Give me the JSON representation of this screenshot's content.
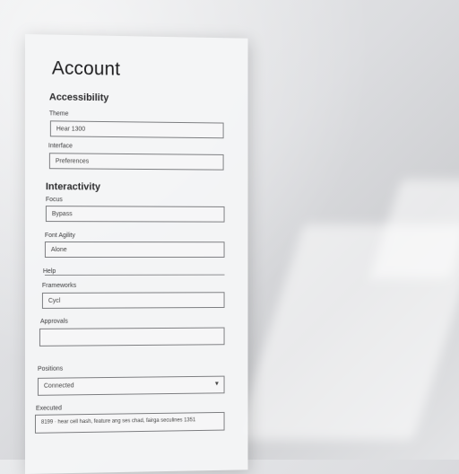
{
  "form": {
    "title": "Account",
    "section_account": "Accessibility",
    "label_1": "Theme",
    "value_1": "Hear 1300",
    "label_2": "Interface",
    "value_2": "Preferences",
    "section_interactivity": "Interactivity",
    "label_3": "Focus",
    "value_3": "Bypass",
    "label_4": "Font Agility",
    "value_4": "Alone",
    "label_5": "Help",
    "label_6": "Frameworks",
    "value_6": "Cycl",
    "label_7": "Approvals",
    "value_7": "",
    "label_8": "Positions",
    "select_value": "Connected",
    "label_9": "Executed",
    "value_9": "8199 · hear cell hash, feature ang ses chad, fairga seculines 1351"
  }
}
